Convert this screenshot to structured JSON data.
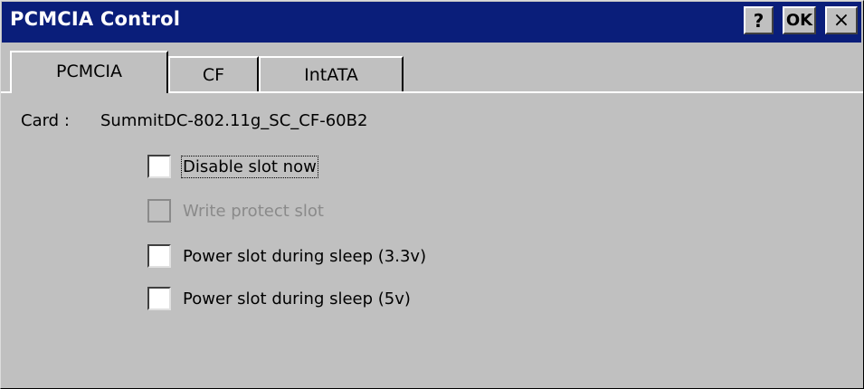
{
  "window": {
    "title": "PCMCIA Control",
    "help_label": "?",
    "ok_label": "OK",
    "close_label": "×"
  },
  "tabs": [
    {
      "label": "PCMCIA",
      "active": true
    },
    {
      "label": "CF",
      "active": false
    },
    {
      "label": "IntATA",
      "active": false
    }
  ],
  "card": {
    "label": "Card :",
    "value": "SummitDC-802.11g_SC_CF-60B2"
  },
  "options": [
    {
      "label": "Disable slot now",
      "checked": false,
      "enabled": true,
      "focused": true
    },
    {
      "label": "Write protect slot",
      "checked": false,
      "enabled": false,
      "focused": false
    },
    {
      "label": "Power slot during sleep (3.3v)",
      "checked": false,
      "enabled": true,
      "focused": false
    },
    {
      "label": "Power slot during sleep (5v)",
      "checked": false,
      "enabled": true,
      "focused": false
    }
  ],
  "colors": {
    "titlebar": "#0a1e7a",
    "face": "#c0c0c0",
    "disabled_text": "#8a8a8a"
  }
}
